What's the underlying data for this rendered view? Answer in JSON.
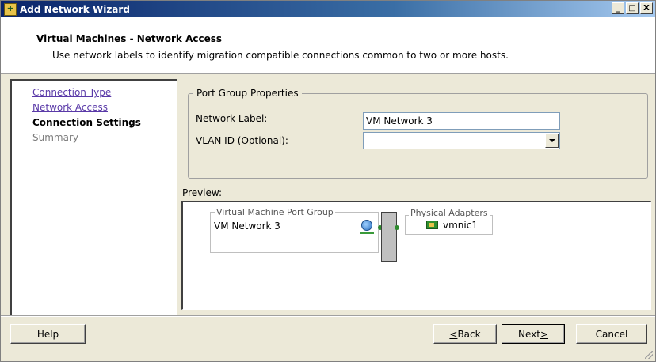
{
  "window": {
    "title": "Add Network Wizard",
    "minimize_label": "_",
    "maximize_label": "□",
    "close_label": "X"
  },
  "header": {
    "title": "Virtual Machines - Network Access",
    "subtitle": "Use network labels to identify migration compatible connections common to two or more hosts."
  },
  "nav": {
    "items": [
      {
        "label": "Connection Type",
        "state": "visited"
      },
      {
        "label": "Network Access",
        "state": "visited"
      },
      {
        "label": "Connection Settings",
        "state": "current"
      },
      {
        "label": "Summary",
        "state": "future"
      }
    ]
  },
  "port_group": {
    "title": "Port Group Properties",
    "network_label_caption": "Network Label:",
    "network_label_value": "VM Network 3",
    "vlan_caption": "VLAN ID (Optional):",
    "vlan_value": ""
  },
  "preview": {
    "label": "Preview:",
    "vm_group_title": "Virtual Machine Port Group",
    "vm_network_name": "VM Network 3",
    "physical_adapters_title": "Physical Adapters",
    "adapter_name": "vmnic1"
  },
  "footer": {
    "help_label": "Help",
    "back_prefix": "",
    "back_mnemonic": "<",
    "back_label": " Back",
    "next_label": "Next ",
    "next_mnemonic": ">",
    "cancel_label": "Cancel"
  },
  "colors": {
    "link": "#5a3aa8",
    "connector": "#2e8b2e",
    "titlebar": "#0a246a"
  }
}
